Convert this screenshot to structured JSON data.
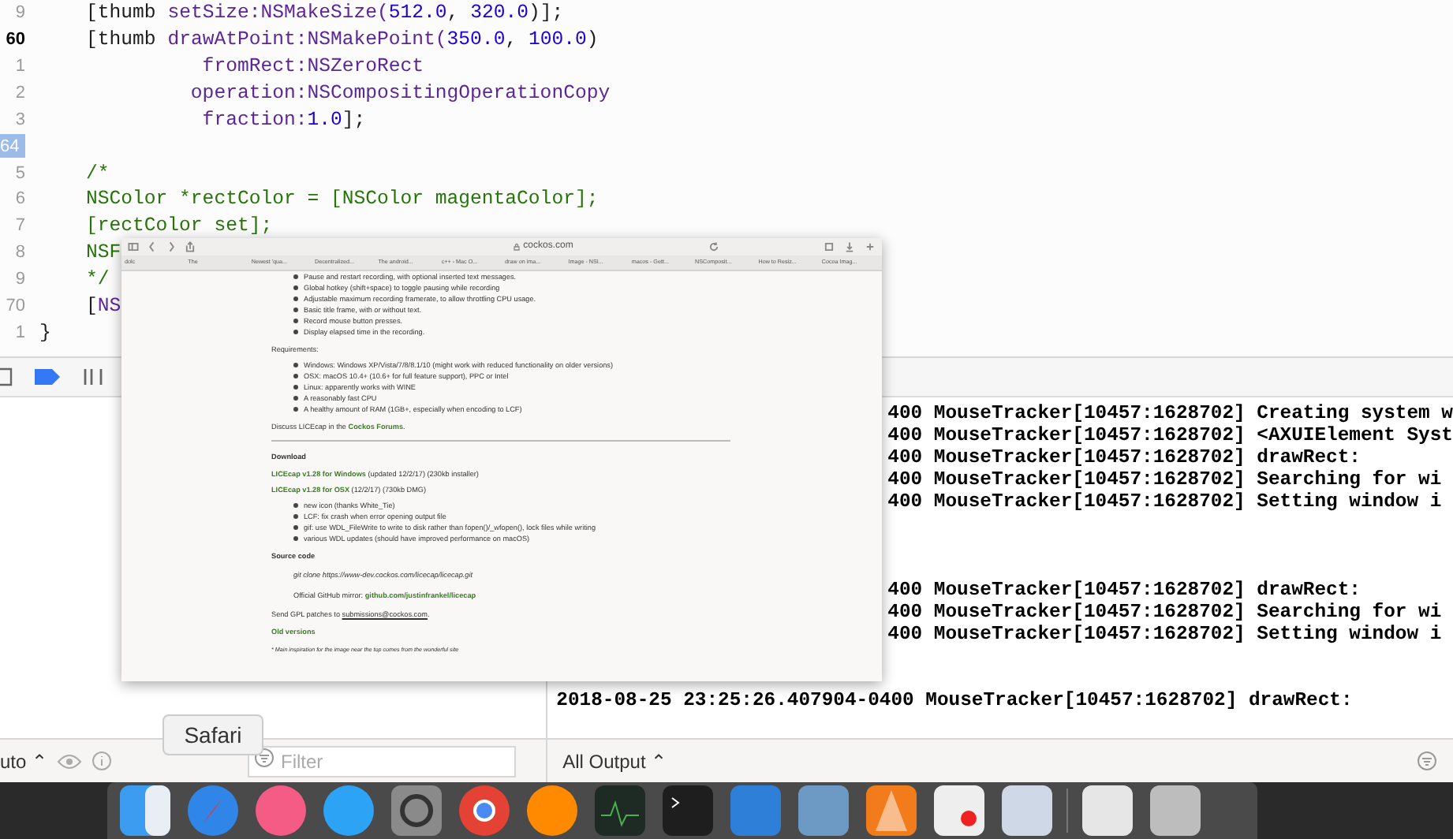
{
  "editor": {
    "lines": [
      {
        "number": "9",
        "current": false,
        "breakpoint": false,
        "tokens": [
          {
            "text": "    [thumb ",
            "kind": "plain"
          },
          {
            "text": "setSize:NSMakeSize(",
            "kind": "method"
          },
          {
            "text": "512.0",
            "kind": "number"
          },
          {
            "text": ", ",
            "kind": "plain"
          },
          {
            "text": "320.0",
            "kind": "number"
          },
          {
            "text": ")];",
            "kind": "plain"
          }
        ]
      },
      {
        "number": "60",
        "current": true,
        "breakpoint": false,
        "tokens": [
          {
            "text": "    [thumb ",
            "kind": "plain"
          },
          {
            "text": "drawAtPoint:NSMakePoint(",
            "kind": "method"
          },
          {
            "text": "350.0",
            "kind": "number"
          },
          {
            "text": ", ",
            "kind": "plain"
          },
          {
            "text": "100.0",
            "kind": "number"
          },
          {
            "text": ")",
            "kind": "plain"
          }
        ]
      },
      {
        "number": "1",
        "current": false,
        "breakpoint": false,
        "tokens": [
          {
            "text": "              fromRect:NSZeroRect",
            "kind": "method"
          }
        ]
      },
      {
        "number": "2",
        "current": false,
        "breakpoint": false,
        "tokens": [
          {
            "text": "             operation:NSCompositingOperationCopy",
            "kind": "method"
          }
        ]
      },
      {
        "number": "3",
        "current": false,
        "breakpoint": false,
        "tokens": [
          {
            "text": "              fraction:",
            "kind": "method"
          },
          {
            "text": "1.0",
            "kind": "number"
          },
          {
            "text": "];",
            "kind": "plain"
          }
        ]
      },
      {
        "number": "64",
        "current": false,
        "breakpoint": true
      },
      {
        "number": "5",
        "current": false,
        "breakpoint": false,
        "tokens": [
          {
            "text": "    /*",
            "kind": "comment"
          }
        ]
      },
      {
        "number": "6",
        "current": false,
        "breakpoint": false,
        "tokens": [
          {
            "text": "    NSColor *rectColor = [NSColor magentaColor];",
            "kind": "comment"
          }
        ]
      },
      {
        "number": "7",
        "current": false,
        "breakpoint": false,
        "tokens": [
          {
            "text": "    [rectColor set];",
            "kind": "comment"
          }
        ]
      },
      {
        "number": "8",
        "current": false,
        "breakpoint": false,
        "tokens": [
          {
            "text": "    NSF",
            "kind": "comment"
          }
        ]
      },
      {
        "number": "9",
        "current": false,
        "breakpoint": false,
        "tokens": [
          {
            "text": "    */",
            "kind": "comment"
          }
        ]
      },
      {
        "number": "70",
        "current": false,
        "breakpoint": false,
        "tokens": [
          {
            "text": "    [",
            "kind": "plain"
          },
          {
            "text": "NS",
            "kind": "method"
          }
        ]
      },
      {
        "number": "1",
        "current": false,
        "breakpoint": false,
        "tokens": [
          {
            "text": "}",
            "kind": "plain"
          }
        ]
      }
    ]
  },
  "variables_bar": {
    "scope": "uto ⌃",
    "filter_placeholder": "Filter"
  },
  "console": {
    "lines": [
      {
        "kind": "partial",
        "text": "400 MouseTracker[10457:1628702] Creating system w"
      },
      {
        "kind": "partial",
        "text": "400 MouseTracker[10457:1628702] <AXUIElement Syst"
      },
      {
        "kind": "partial",
        "text": "400 MouseTracker[10457:1628702] drawRect:"
      },
      {
        "kind": "partial",
        "text": "400 MouseTracker[10457:1628702] Searching for wi"
      },
      {
        "kind": "partial",
        "text": "400 MouseTracker[10457:1628702] Setting window i"
      },
      {
        "kind": "blank"
      },
      {
        "kind": "blank"
      },
      {
        "kind": "blank"
      },
      {
        "kind": "partial",
        "text": "400 MouseTracker[10457:1628702] drawRect:"
      },
      {
        "kind": "partial",
        "text": "400 MouseTracker[10457:1628702] Searching for wi"
      },
      {
        "kind": "partial",
        "text": "400 MouseTracker[10457:1628702] Setting window i"
      },
      {
        "kind": "blank"
      },
      {
        "kind": "blank"
      },
      {
        "kind": "full",
        "text": "2018-08-25 23:25:26.407904-0400 MouseTracker[10457:1628702] drawRect:"
      }
    ],
    "output_menu": "All Output ⌃"
  },
  "dock": {
    "tooltip": "Safari"
  },
  "browser": {
    "address": "cockos.com",
    "tabs": [
      "dolc",
      "The",
      "Newest 'qua...",
      "Decentralized...",
      "The android...",
      "c++ - Mac O...",
      "draw on ima...",
      "Image - NSI...",
      "macos - Gett...",
      "NSComposit...",
      "How to Resiz...",
      "Cocoa Imag..."
    ],
    "blocks": [
      {
        "kind": "bullets",
        "items": [
          "Pause and restart recording, with optional inserted text messages.",
          "Global hotkey (shift+space) to toggle pausing while recording",
          "Adjustable maximum recording framerate, to allow throttling CPU usage.",
          "Basic title frame, with or without text.",
          "Record mouse button presses.",
          "Display elapsed time in the recording."
        ]
      },
      {
        "kind": "para",
        "parts": [
          {
            "text": "Requirements:",
            "kind": "plain"
          }
        ]
      },
      {
        "kind": "bullets",
        "items": [
          "Windows: Windows XP/Vista/7/8/8.1/10 (might work with reduced functionality on older versions)",
          "OSX: macOS 10.4+ (10.6+ for full feature support), PPC or Intel",
          "Linux: apparently works with WINE",
          "A reasonably fast CPU",
          "A healthy amount of RAM (1GB+, especially when encoding to LCF)"
        ]
      },
      {
        "kind": "para",
        "parts": [
          {
            "text": "Discuss LICEcap in the ",
            "kind": "plain"
          },
          {
            "text": "Cockos Forums",
            "kind": "link"
          },
          {
            "text": ".",
            "kind": "plain"
          }
        ]
      },
      {
        "kind": "rule"
      },
      {
        "kind": "heading",
        "text": "Download"
      },
      {
        "kind": "para",
        "parts": [
          {
            "text": "LICEcap v1.28 for Windows",
            "kind": "link"
          },
          {
            "text": " (updated 12/2/17) (230kb installer)",
            "kind": "plain"
          }
        ]
      },
      {
        "kind": "para",
        "parts": [
          {
            "text": "LICEcap v1.28 for OSX",
            "kind": "link"
          },
          {
            "text": " (12/2/17) (730kb DMG)",
            "kind": "plain"
          }
        ]
      },
      {
        "kind": "bullets",
        "items": [
          "new icon (thanks White_Tie)",
          "LCF: fix crash when error opening output file",
          "gif: use WDL_FileWrite to write to disk rather than fopen()/_wfopen(), lock files while writing",
          "various WDL updates (should have improved performance on macOS)"
        ]
      },
      {
        "kind": "heading",
        "text": "Source code"
      },
      {
        "kind": "indent",
        "parts": [
          {
            "text": "git clone https://www-dev.cockos.com/licecap/licecap.git",
            "kind": "italic"
          }
        ]
      },
      {
        "kind": "indent",
        "parts": [
          {
            "text": "Official GitHub mirror: ",
            "kind": "plain"
          },
          {
            "text": "github.com/justinfrankel/licecap",
            "kind": "link"
          }
        ]
      },
      {
        "kind": "para",
        "parts": [
          {
            "text": "Send GPL patches to ",
            "kind": "plain"
          },
          {
            "text": "submissions@cockos.com",
            "kind": "underline"
          },
          {
            "text": ".",
            "kind": "plain"
          }
        ]
      },
      {
        "kind": "heading_link",
        "text": "Old versions"
      },
      {
        "kind": "note",
        "text": "* Main inspiration for the image near the top comes from the wonderful site"
      }
    ]
  }
}
